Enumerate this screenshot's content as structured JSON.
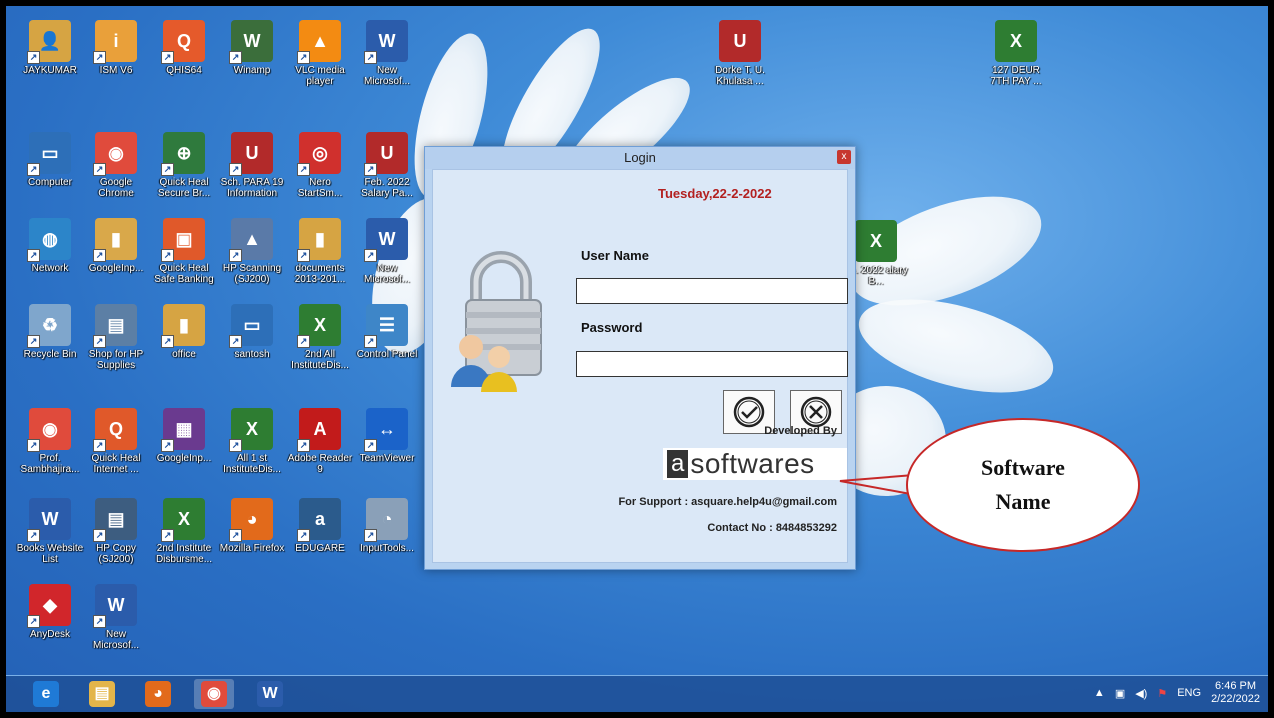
{
  "desktop_icons": [
    {
      "label": "JAYKUMAR",
      "color": "#d6a443",
      "glyph": "👤"
    },
    {
      "label": "ISM V6",
      "color": "#e9a03a",
      "glyph": "i"
    },
    {
      "label": "QHIS64",
      "color": "#e55a2b",
      "glyph": "Q"
    },
    {
      "label": "Winamp",
      "color": "#3b6e3b",
      "glyph": "W"
    },
    {
      "label": "VLC media player",
      "color": "#f38b12",
      "glyph": "▲"
    },
    {
      "label": "New Microsof...",
      "color": "#2b5cab",
      "glyph": "W"
    },
    {
      "label": "Computer",
      "color": "#2d6fb8",
      "glyph": "▭"
    },
    {
      "label": "Google Chrome",
      "color": "#e04b3c",
      "glyph": "◉"
    },
    {
      "label": "Quick Heal Secure Br...",
      "color": "#2f7a3d",
      "glyph": "⊕"
    },
    {
      "label": "Sch. PARA 19 Information",
      "color": "#b22a2a",
      "glyph": "U"
    },
    {
      "label": "Nero StartSm...",
      "color": "#d0302d",
      "glyph": "◎"
    },
    {
      "label": "Feb. 2022 Salary Pa...",
      "color": "#b22a2a",
      "glyph": "U"
    },
    {
      "label": "Network",
      "color": "#2c85c9",
      "glyph": "◍"
    },
    {
      "label": "GoogleInp...",
      "color": "#d9a84a",
      "glyph": "▮"
    },
    {
      "label": "Quick Heal Safe Banking",
      "color": "#e0592a",
      "glyph": "▣"
    },
    {
      "label": "HP Scanning (SJ200)",
      "color": "#5a7aa8",
      "glyph": "▲"
    },
    {
      "label": "documents 2013-201...",
      "color": "#d6a443",
      "glyph": "▮"
    },
    {
      "label": "New Microsof...",
      "color": "#2b5cab",
      "glyph": "W"
    },
    {
      "label": "Recycle Bin",
      "color": "#7fa6cc",
      "glyph": "♻"
    },
    {
      "label": "Shop for HP Supplies",
      "color": "#5c7fa5",
      "glyph": "▤"
    },
    {
      "label": "office",
      "color": "#d6a443",
      "glyph": "▮"
    },
    {
      "label": "santosh",
      "color": "#2d6fb8",
      "glyph": "▭"
    },
    {
      "label": "2nd All InstituteDis...",
      "color": "#2e7d32",
      "glyph": "X"
    },
    {
      "label": "Control Panel",
      "color": "#3e86c8",
      "glyph": "☰"
    },
    {
      "label": "Prof. Sambhajira...",
      "color": "#e04b3c",
      "glyph": "◉"
    },
    {
      "label": "Quick Heal Internet ...",
      "color": "#e0592a",
      "glyph": "Q"
    },
    {
      "label": "GoogleInp...",
      "color": "#6a3a8f",
      "glyph": "▦"
    },
    {
      "label": "All 1 st InstituteDis...",
      "color": "#2e7d32",
      "glyph": "X"
    },
    {
      "label": "Adobe Reader 9",
      "color": "#c21b1b",
      "glyph": "A"
    },
    {
      "label": "TeamViewer",
      "color": "#1b63c9",
      "glyph": "↔"
    },
    {
      "label": "Books Website List",
      "color": "#2b5cab",
      "glyph": "W"
    },
    {
      "label": "HP Copy (SJ200)",
      "color": "#3d5d80",
      "glyph": "▤"
    },
    {
      "label": "2nd Institute Disbursme...",
      "color": "#2e7d32",
      "glyph": "X"
    },
    {
      "label": "Mozilla Firefox",
      "color": "#e26a1b",
      "glyph": "◕"
    },
    {
      "label": "EDUGARE",
      "color": "#2b5b8c",
      "glyph": "a"
    },
    {
      "label": "InputTools...",
      "color": "#8aa0b8",
      "glyph": "◔"
    },
    {
      "label": "AnyDesk",
      "color": "#d1262b",
      "glyph": "◆"
    },
    {
      "label": "New Microsof...",
      "color": "#2b5cab",
      "glyph": "W"
    }
  ],
  "right_icons": [
    {
      "label": "Dorke T. U. Khulasa ...",
      "color": "#b22a2a",
      "glyph": "U"
    },
    {
      "label": "127 DEUR 7TH PAY ...",
      "color": "#2e7d32",
      "glyph": "X"
    },
    {
      "label": "an. 2022 alary B...",
      "color": "#2e7d32",
      "glyph": "X"
    }
  ],
  "login": {
    "title": "Login",
    "close": "x",
    "date": "Tuesday,22-2-2022",
    "username_label": "User Name",
    "username_value": "",
    "password_label": "Password",
    "password_value": "",
    "ok_icon": "✓",
    "cancel_icon": "✕",
    "developed_by": "Developed By",
    "brand_a": "a",
    "brand_rest": "softwares",
    "support": "For Support : asquare.help4u@gmail.com",
    "contact": "Contact No : 8484853292"
  },
  "callout": {
    "line1": "Software",
    "line2": "Name"
  },
  "taskbar": {
    "apps": [
      {
        "name": "Internet Explorer",
        "glyph": "e",
        "color": "#1f7ad6"
      },
      {
        "name": "File Explorer",
        "glyph": "▤",
        "color": "#e3b54a"
      },
      {
        "name": "Firefox",
        "glyph": "◕",
        "color": "#e26a1b"
      },
      {
        "name": "Chrome",
        "glyph": "◉",
        "color": "#e04b3c"
      },
      {
        "name": "Word",
        "glyph": "W",
        "color": "#2b5cab"
      }
    ],
    "lang": "ENG",
    "time": "6:46 PM",
    "date": "2/22/2022"
  }
}
